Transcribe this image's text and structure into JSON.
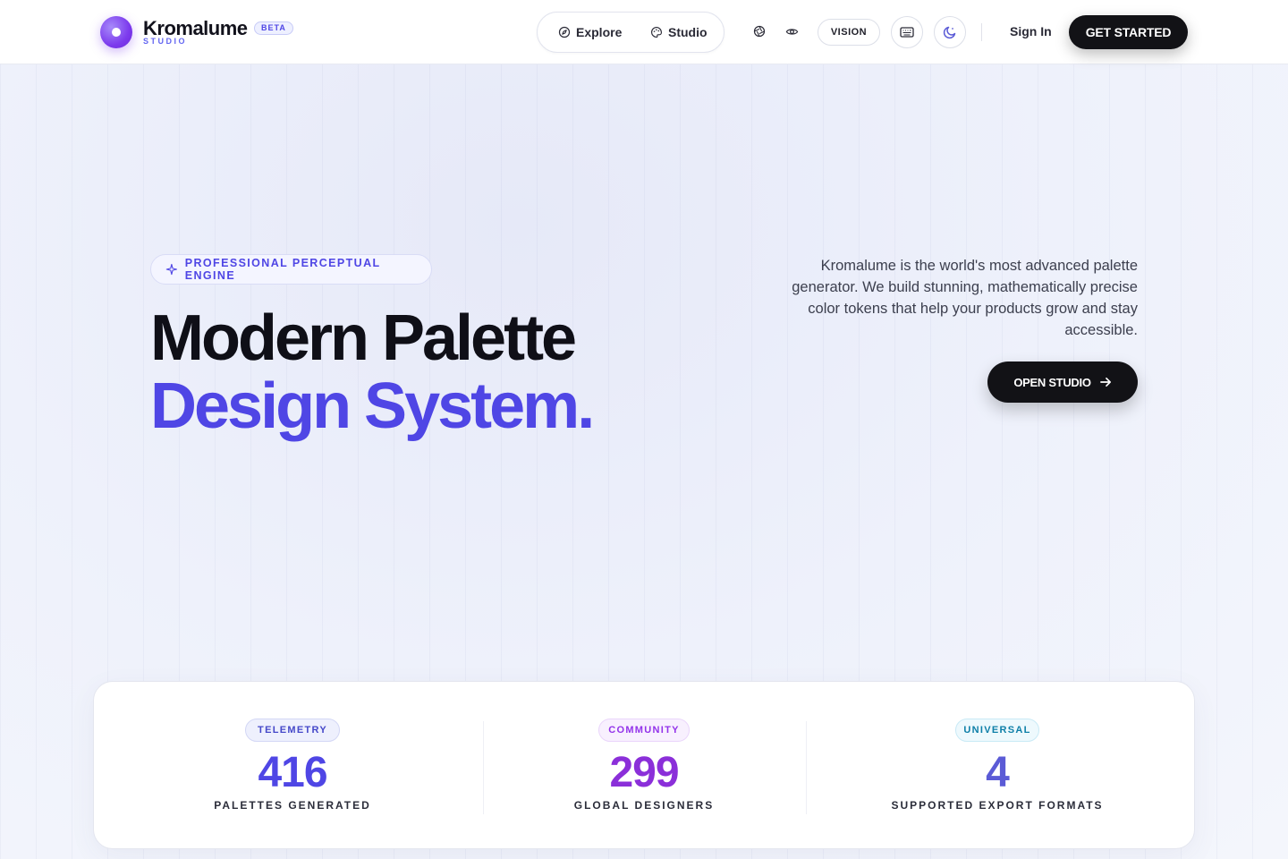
{
  "nav": {
    "brand_name": "Kromalume",
    "brand_sub": "STUDIO",
    "beta_label": "BETA",
    "links": [
      {
        "label": "Explore",
        "icon": "compass-icon"
      },
      {
        "label": "Studio",
        "icon": "palette-icon"
      }
    ],
    "vision_label": "VISION",
    "sign_in_label": "Sign In",
    "get_started_label": "GET STARTED"
  },
  "hero": {
    "badge": "PROFESSIONAL PERCEPTUAL ENGINE",
    "headline_line1": "Modern Palette",
    "headline_line2": "Design System.",
    "description": "Kromalume is the world's most advanced palette generator. We build stunning, mathematically precise color tokens that help your products grow and stay accessible.",
    "cta_label": "OPEN STUDIO"
  },
  "stats": [
    {
      "tag": "TELEMETRY",
      "value": "416",
      "label": "PALETTES GENERATED",
      "color": "#4f46e5"
    },
    {
      "tag": "COMMUNITY",
      "value": "299",
      "label": "GLOBAL DESIGNERS",
      "color": "#8b2fd9"
    },
    {
      "tag": "UNIVERSAL",
      "value": "4",
      "label": "SUPPORTED EXPORT FORMATS",
      "color": "#5b5bd6"
    }
  ],
  "colors": {
    "accent": "#4f46e5",
    "dark": "#121216"
  }
}
